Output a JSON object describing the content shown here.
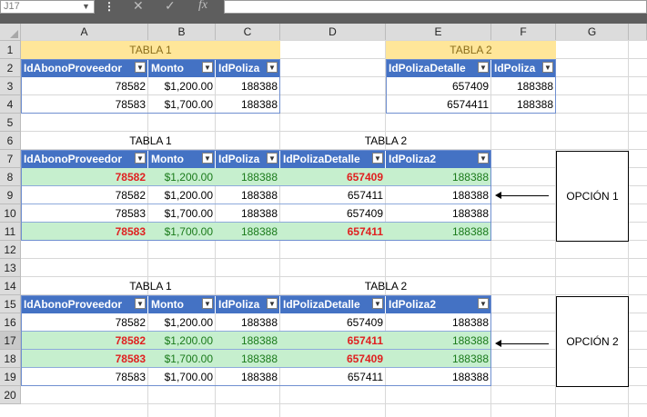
{
  "formula_bar": {
    "name_box": "J17",
    "fx": "fx",
    "cancel": "✕",
    "enter": "✓"
  },
  "columns": [
    "A",
    "B",
    "C",
    "D",
    "E",
    "F",
    "G"
  ],
  "rows": [
    "1",
    "2",
    "3",
    "4",
    "5",
    "6",
    "7",
    "8",
    "9",
    "10",
    "11",
    "12",
    "13",
    "14",
    "15",
    "16",
    "17",
    "18",
    "19",
    "20"
  ],
  "selected_row": "17",
  "top_tables": {
    "tabla1_title": "TABLA 1",
    "tabla1_headers": [
      "IdAbonoProveedor",
      "Monto",
      "IdPoliza"
    ],
    "tabla1_rows": [
      [
        "78582",
        "$1,200.00",
        "188388"
      ],
      [
        "78583",
        "$1,700.00",
        "188388"
      ]
    ],
    "tabla2_title": "TABLA 2",
    "tabla2_headers": [
      "IdPolizaDetalle",
      "IdPoliza"
    ],
    "tabla2_rows": [
      [
        "657409",
        "188388"
      ],
      [
        "6574411",
        "188388"
      ]
    ]
  },
  "option1": {
    "tabla1_title": "TABLA 1",
    "tabla2_title": "TABLA 2",
    "headers": [
      "IdAbonoProveedor",
      "Monto",
      "IdPoliza",
      "IdPolizaDetalle",
      "IdPoliza2"
    ],
    "rows": [
      [
        "78582",
        "$1,200.00",
        "188388",
        "657409",
        "188388"
      ],
      [
        "78582",
        "$1,200.00",
        "188388",
        "657411",
        "188388"
      ],
      [
        "78583",
        "$1,700.00",
        "188388",
        "657409",
        "188388"
      ],
      [
        "78583",
        "$1,700.00",
        "188388",
        "657411",
        "188388"
      ]
    ],
    "label": "OPCIÓN 1"
  },
  "option2": {
    "tabla1_title": "TABLA 1",
    "tabla2_title": "TABLA 2",
    "headers": [
      "IdAbonoProveedor",
      "Monto",
      "IdPoliza",
      "IdPolizaDetalle",
      "IdPoliza2"
    ],
    "rows": [
      [
        "78582",
        "$1,200.00",
        "188388",
        "657409",
        "188388"
      ],
      [
        "78582",
        "$1,200.00",
        "188388",
        "657411",
        "188388"
      ],
      [
        "78583",
        "$1,700.00",
        "188388",
        "657409",
        "188388"
      ],
      [
        "78583",
        "$1,700.00",
        "188388",
        "657411",
        "188388"
      ]
    ],
    "label": "OPCIÓN 2"
  },
  "colors": {
    "header_blue": "#4472c4",
    "highlight_green": "#c6efce",
    "title_yellow": "#ffe699",
    "mismatch_red": "#e02020"
  }
}
